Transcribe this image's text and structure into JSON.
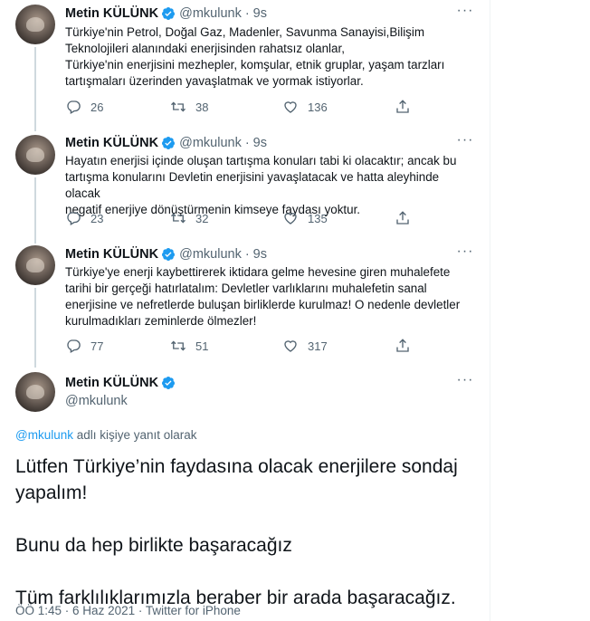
{
  "author": {
    "name": "Metin KÜLÜNK",
    "handle": "@mkulunk"
  },
  "tweets": [
    {
      "time": "9s",
      "text_lines": [
        "Türkiye'nin Petrol, Doğal Gaz, Madenler, Savunma Sanayisi,Bilişim",
        "Teknolojileri alanındaki enerjisinden rahatsız olanlar,",
        "Türkiye'nin enerjisini mezhepler, komşular, etnik gruplar, yaşam tarzları",
        "tartışmaları üzerinden yavaşlatmak ve yormak istiyorlar."
      ],
      "replies": "26",
      "retweets": "38",
      "likes": "136"
    },
    {
      "time": "9s",
      "text_lines": [
        "Hayatın enerjisi içinde oluşan tartışma konuları tabi ki olacaktır; ancak bu",
        "tartışma konularını Devletin enerjisini yavaşlatacak ve hatta aleyhinde olacak",
        "negatif enerjiye dönüştürmenin kimseye faydası yoktur."
      ],
      "replies": "23",
      "retweets": "32",
      "likes": "135"
    },
    {
      "time": "9s",
      "text_lines": [
        "Türkiye'ye enerji kaybettirerek iktidara gelme hevesine giren muhalefete",
        "tarihi bir gerçeği hatırlatalım: Devletler varlıklarını muhalefetin sanal",
        "enerjisine ve nefretlerde buluşan birliklerde kurulmaz! O nedenle devletler",
        "kurulmadıkları zeminlerde ölmezler!"
      ],
      "replies": "77",
      "retweets": "51",
      "likes": "317"
    }
  ],
  "main_tweet": {
    "reply_link": "@mkulunk",
    "reply_suffix": " adlı kişiye yanıt olarak",
    "lines": [
      "Lütfen Türkiye’nin faydasına olacak enerjilere sondaj",
      "yapalım!",
      "",
      "Bunu da hep birlikte başaracağız",
      "",
      "Tüm farklılıklarımızla beraber bir arada başaracağız."
    ],
    "time": "ÖÖ 1:45",
    "date": "6 Haz 2021",
    "source": "Twitter for iPhone"
  },
  "icons": {
    "more": "more-icon",
    "reply": "reply-icon",
    "retweet": "retweet-icon",
    "like": "like-icon",
    "share": "share-icon",
    "verified": "verified-badge-icon"
  },
  "colors": {
    "accent": "#1d9bf0",
    "muted": "#536471",
    "text": "#0f1419"
  }
}
